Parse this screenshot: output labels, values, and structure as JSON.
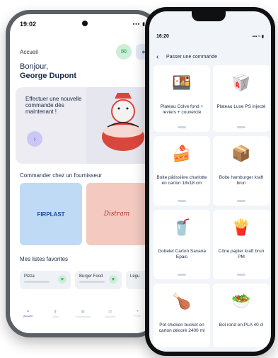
{
  "phone_android": {
    "status_time": "19:02",
    "status_icons": "▪▪▪ ▮",
    "page_title": "Accueil",
    "greeting": "Bonjour,",
    "user_name": "George Dupont",
    "banner_text": "Effectuer une nouvelle commande dès maintenant !",
    "banner_button_icon": "chevron-right-icon",
    "section_suppliers": "Commander chez un fournisseur",
    "suppliers": [
      {
        "name": "FIRPLAST",
        "color": "#bfdaf5"
      },
      {
        "name": "Distram",
        "color": "#f3c9c0"
      }
    ],
    "section_favorites": "Mes listes favorites",
    "favorites": [
      {
        "label": "Pizza"
      },
      {
        "label": "Burger Food"
      },
      {
        "label": "Légu"
      }
    ],
    "tabs": [
      {
        "label": "Accueil",
        "icon": "home-icon"
      },
      {
        "label": "Listes",
        "icon": "bookmark-icon"
      },
      {
        "label": "Commandes",
        "icon": "bag-icon"
      },
      {
        "label": "Factures",
        "icon": "document-icon"
      },
      {
        "label": "Profil",
        "icon": "user-icon"
      }
    ]
  },
  "phone_iphone": {
    "status_time": "16:20",
    "status_icons": "▪▪▪ ≈ ▮",
    "back_icon": "back-arrow-icon",
    "page_title": "Passer une commande",
    "products": [
      {
        "name": "Plateau Colve fond + reviers + couvercle",
        "icon": "🍱"
      },
      {
        "name": "Plateau Luxe PS injecté",
        "icon": "🥡"
      },
      {
        "name": "Boite pâtissière charlotte en carton 18x18 cm",
        "icon": "🍰"
      },
      {
        "name": "Boite hamburger kraft brun",
        "icon": "📦"
      },
      {
        "name": "Gobelet Carton Savana Epais",
        "icon": "🥤"
      },
      {
        "name": "Cône papier kraft brun PM",
        "icon": "🍟"
      },
      {
        "name": "Pot chicken bucket en carton décoré 2400 ml",
        "icon": "🍗"
      },
      {
        "name": "Bol rond en PLA 40 cl",
        "icon": "🥗"
      }
    ]
  }
}
